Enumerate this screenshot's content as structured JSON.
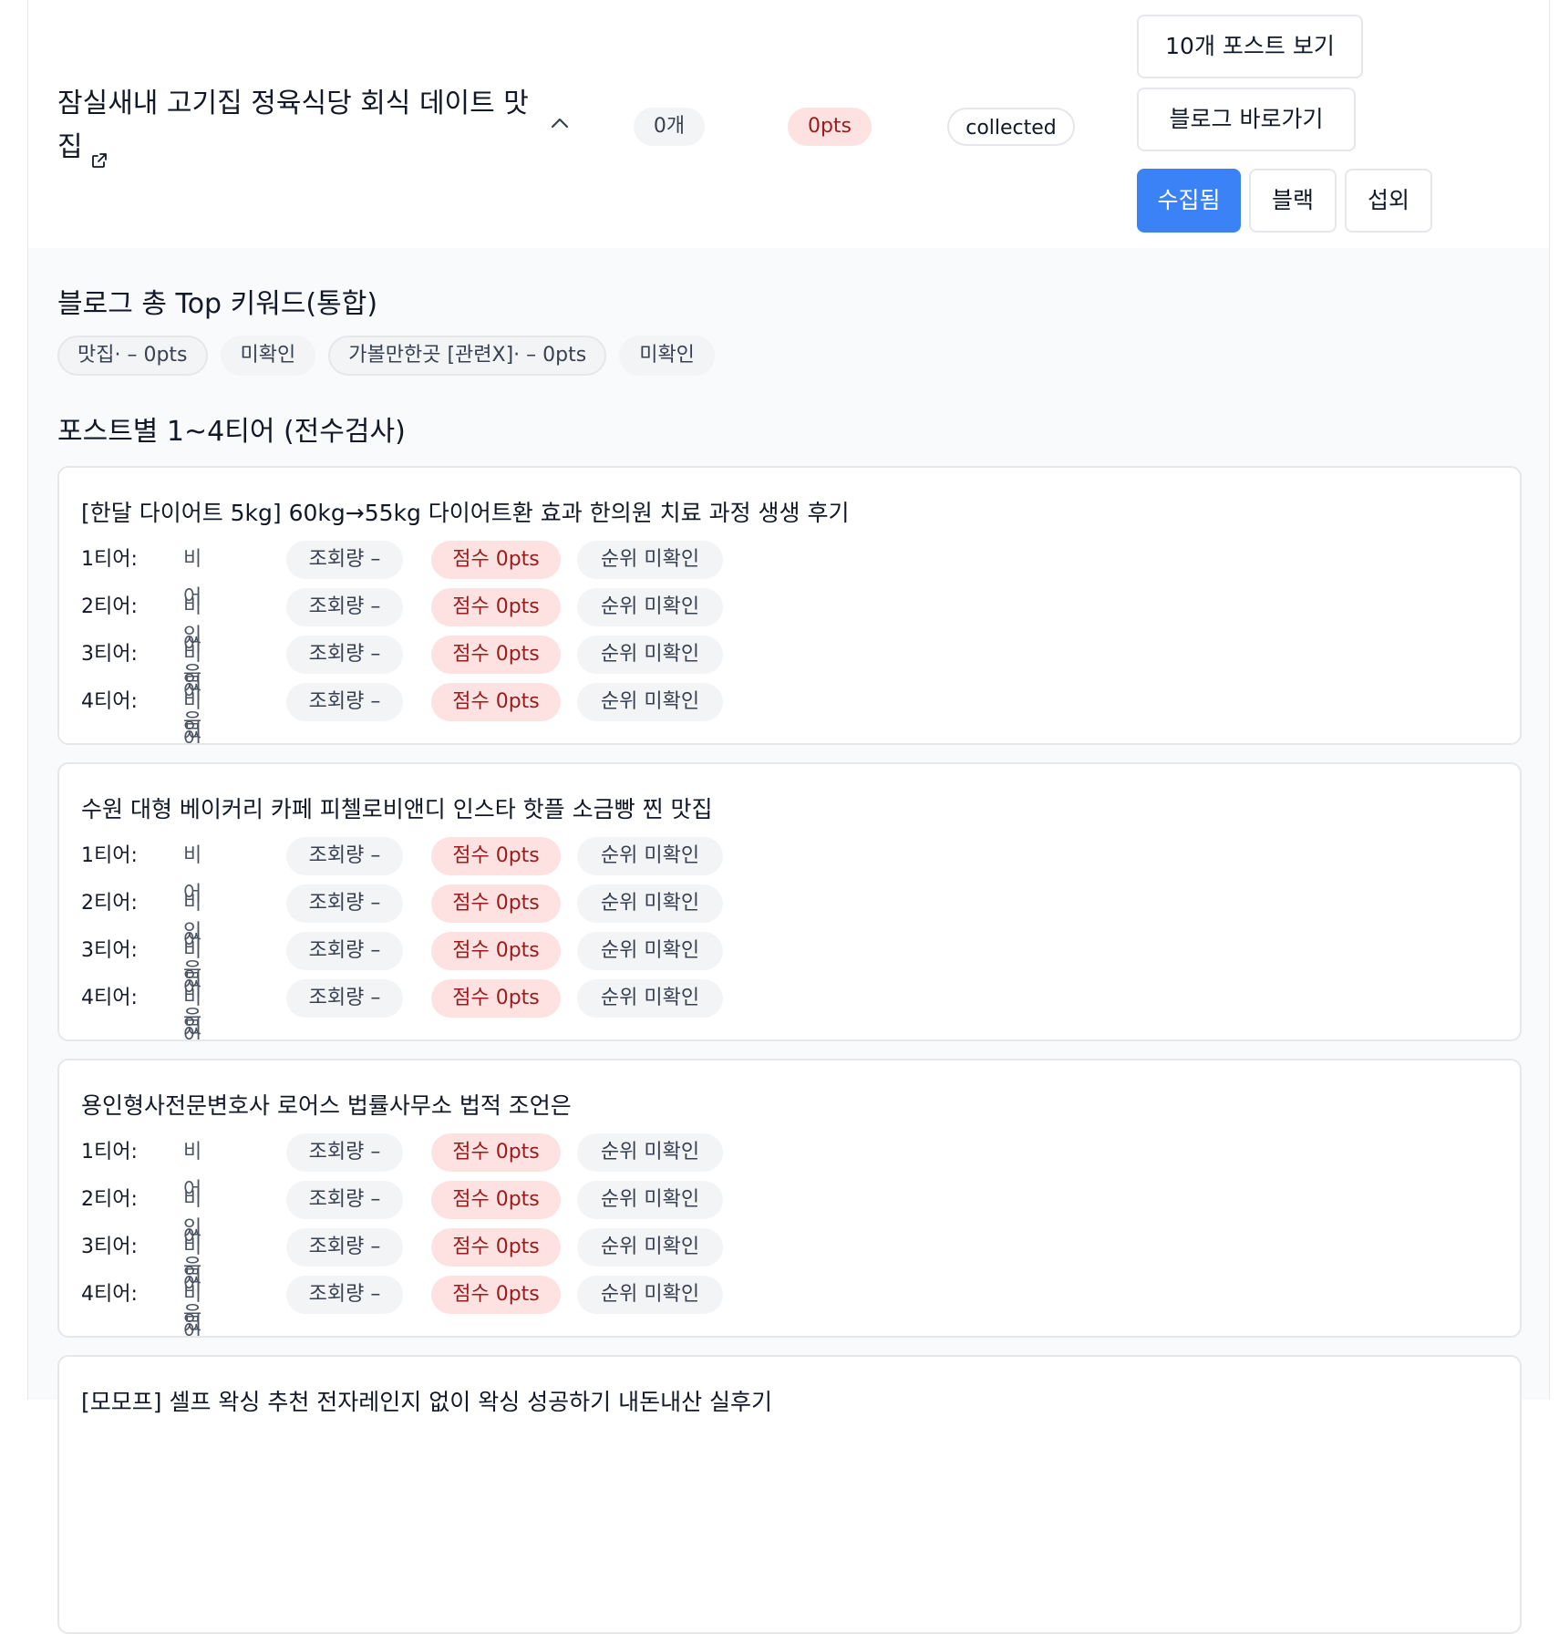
{
  "header": {
    "blog_title": "잠실새내 고기집 정육식당 회식 데이트 맛집",
    "post_count": "0개",
    "points": "0pts",
    "status": "collected",
    "btn_view_posts": "10개 포스트 보기",
    "btn_go_blog": "블로그 바로가기",
    "btn_collected": "수집됨",
    "btn_black": "블랙",
    "btn_outreach": "섭외"
  },
  "top_keywords": {
    "title": "블로그 총 Top 키워드(통합)",
    "items": [
      {
        "label": "맛집· – 0pts",
        "status": "미확인"
      },
      {
        "label": "가볼만한곳 [관련X]· – 0pts",
        "status": "미확인"
      }
    ]
  },
  "tier_section": {
    "title": "포스트별 1~4티어 (전수검사)",
    "posts": [
      {
        "title": "[한달 다이어트 5kg] 60kg→55kg 다이어트환 효과 한의원 치료 과정 생생 후기",
        "tiers": [
          {
            "label": "1티어:",
            "value": "비어있음",
            "views": "조회량 –",
            "score": "점수 0pts",
            "rank": "순위 미확인"
          },
          {
            "label": "2티어:",
            "value": "비어있음",
            "views": "조회량 –",
            "score": "점수 0pts",
            "rank": "순위 미확인"
          },
          {
            "label": "3티어:",
            "value": "비어있음",
            "views": "조회량 –",
            "score": "점수 0pts",
            "rank": "순위 미확인"
          },
          {
            "label": "4티어:",
            "value": "비어있음",
            "views": "조회량 –",
            "score": "점수 0pts",
            "rank": "순위 미확인"
          }
        ]
      },
      {
        "title": "수원 대형 베이커리 카페 피첼로비앤디 인스타 핫플 소금빵 찐 맛집",
        "tiers": [
          {
            "label": "1티어:",
            "value": "비어있음",
            "views": "조회량 –",
            "score": "점수 0pts",
            "rank": "순위 미확인"
          },
          {
            "label": "2티어:",
            "value": "비어있음",
            "views": "조회량 –",
            "score": "점수 0pts",
            "rank": "순위 미확인"
          },
          {
            "label": "3티어:",
            "value": "비어있음",
            "views": "조회량 –",
            "score": "점수 0pts",
            "rank": "순위 미확인"
          },
          {
            "label": "4티어:",
            "value": "비어있음",
            "views": "조회량 –",
            "score": "점수 0pts",
            "rank": "순위 미확인"
          }
        ]
      },
      {
        "title": "용인형사전문변호사 로어스 법률사무소 법적 조언은",
        "tiers": [
          {
            "label": "1티어:",
            "value": "비어있음",
            "views": "조회량 –",
            "score": "점수 0pts",
            "rank": "순위 미확인"
          },
          {
            "label": "2티어:",
            "value": "비어있음",
            "views": "조회량 –",
            "score": "점수 0pts",
            "rank": "순위 미확인"
          },
          {
            "label": "3티어:",
            "value": "비어있음",
            "views": "조회량 –",
            "score": "점수 0pts",
            "rank": "순위 미확인"
          },
          {
            "label": "4티어:",
            "value": "비어있음",
            "views": "조회량 –",
            "score": "점수 0pts",
            "rank": "순위 미확인"
          }
        ]
      },
      {
        "title": "[모모프] 셀프 왁싱 추천 전자레인지 없이 왁싱 성공하기 내돈내산 실후기",
        "tiers": []
      }
    ]
  },
  "colors": {
    "primary": "#3b82f6",
    "score_bg": "#fee2e2",
    "score_text": "#991b1b",
    "neutral_bg": "#f3f4f6"
  }
}
